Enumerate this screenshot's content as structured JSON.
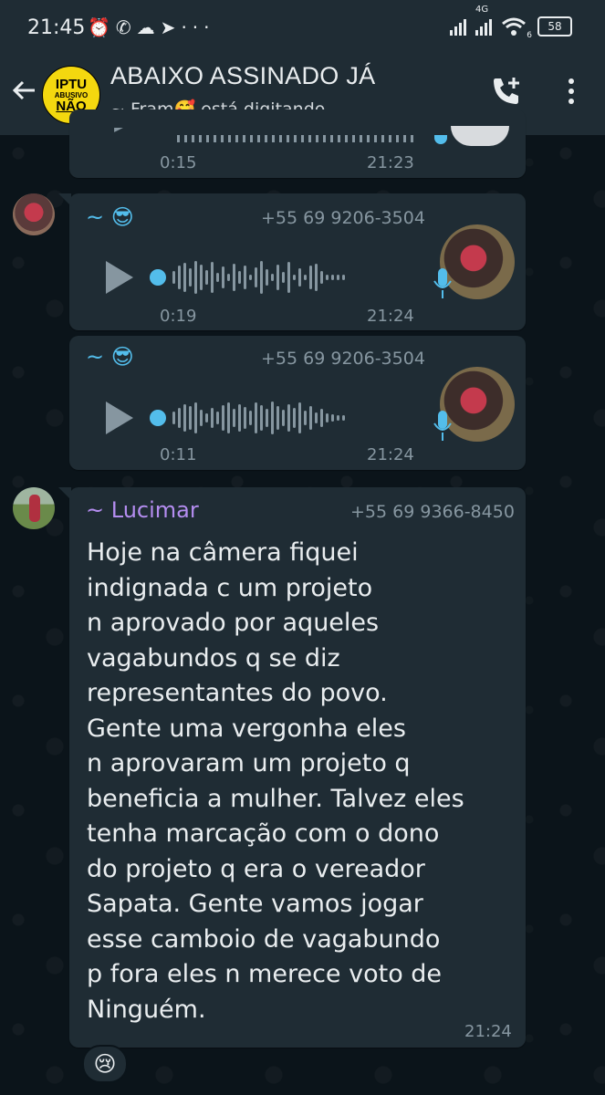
{
  "status_bar": {
    "time": "21:45",
    "icons": [
      "alarm-icon",
      "whatsapp-icon",
      "cloud-icon",
      "telegram-icon",
      "more-dots-icon"
    ],
    "network": "4G",
    "wifi_badge": "6",
    "battery": "58"
  },
  "header": {
    "avatar_lines": [
      "IPTU",
      "ABUSIVO",
      "NÃO"
    ],
    "title": "ABAIXO ASSINADO JÁ",
    "status": "~ Fram🥰 está digitando..."
  },
  "messages": [
    {
      "type": "voice",
      "duration": "0:15",
      "time": "21:23"
    },
    {
      "type": "voice",
      "sender": "~ 😎",
      "phone": "+55 69 9206-3504",
      "duration": "0:19",
      "time": "21:24"
    },
    {
      "type": "voice",
      "sender": "~ 😎",
      "phone": "+55 69 9206-3504",
      "duration": "0:11",
      "time": "21:24"
    },
    {
      "type": "text",
      "sender": "~ Lucimar",
      "sender_color": "#b48df0",
      "phone": "+55 69 9366-8450",
      "text": "Hoje na câmera fiquei\nindignada c um projeto\nn aprovado por aqueles\nvagabundos q se diz\nrepresentantes do povo.\nGente uma vergonha eles\nn aprovaram um projeto q\nbeneficia a mulher. Talvez eles\ntenha marcação com o dono\ndo projeto q era o vereador\nSapata. Gente vamos jogar\nesse camboio de vagabundo\np fora eles n merece voto de\nNinguém.",
      "time": "21:24",
      "reaction": "😢"
    }
  ],
  "colors": {
    "background": "#0b141a",
    "bubble": "#1f2c34",
    "accent_blue": "#53bdeb",
    "meta_grey": "#8696a0"
  }
}
